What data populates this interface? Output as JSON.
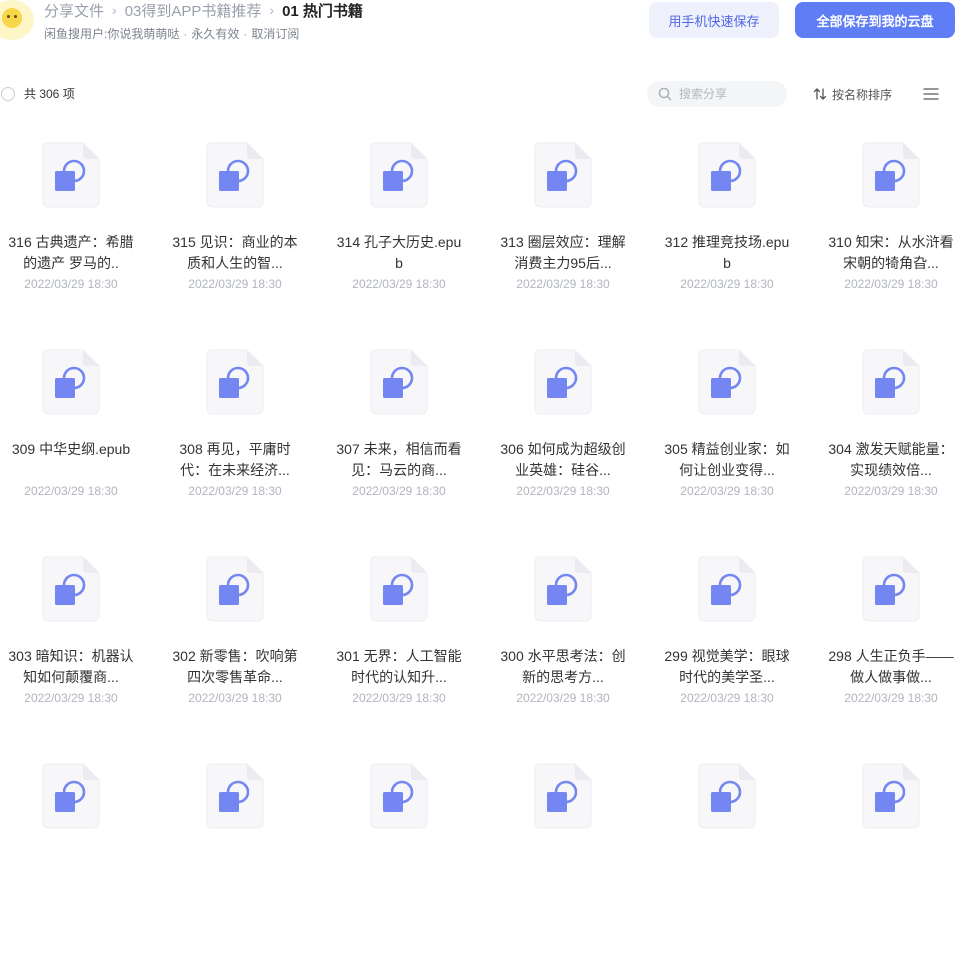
{
  "header": {
    "breadcrumb": [
      "分享文件",
      "03得到APP书籍推荐",
      "01 热门书籍"
    ],
    "separator": "›",
    "sharer": "闲鱼搜用户:你说我萌萌哒",
    "validity": "永久有效",
    "unsubscribe": "取消订阅",
    "dot": "·",
    "save_phone_label": "用手机快速保存",
    "save_all_label": "全部保存到我的云盘"
  },
  "toolbar": {
    "count_label": "共 306 项",
    "search_placeholder": "搜索分享",
    "sort_label": "按名称排序"
  },
  "colors": {
    "accent": "#5f7ef5",
    "file_icon_front": "#7386f2",
    "file_icon_back": "#f7f6f9"
  },
  "files": [
    {
      "name": "316 古典遗产：希腊的遗产 罗马的..",
      "date": "2022/03/29 18:30"
    },
    {
      "name": "315 见识：商业的本质和人生的智...",
      "date": "2022/03/29 18:30"
    },
    {
      "name": "314 孔子大历史.epub",
      "date": "2022/03/29 18:30"
    },
    {
      "name": "313 圈层效应：理解消费主力95后...",
      "date": "2022/03/29 18:30"
    },
    {
      "name": "312 推理竞技场.epub",
      "date": "2022/03/29 18:30"
    },
    {
      "name": "310 知宋：从水浒看宋朝的犄角旮...",
      "date": "2022/03/29 18:30"
    },
    {
      "name": "309 中华史纲.epub",
      "date": "2022/03/29 18:30"
    },
    {
      "name": "308 再见，平庸时代：在未来经济...",
      "date": "2022/03/29 18:30"
    },
    {
      "name": "307 未来，相信而看见：马云的商...",
      "date": "2022/03/29 18:30"
    },
    {
      "name": "306 如何成为超级创业英雄：硅谷...",
      "date": "2022/03/29 18:30"
    },
    {
      "name": "305 精益创业家：如何让创业变得...",
      "date": "2022/03/29 18:30"
    },
    {
      "name": "304 激发天赋能量：实现绩效倍...",
      "date": "2022/03/29 18:30"
    },
    {
      "name": "303 暗知识：机器认知如何颠覆商...",
      "date": "2022/03/29 18:30"
    },
    {
      "name": "302 新零售：吹响第四次零售革命...",
      "date": "2022/03/29 18:30"
    },
    {
      "name": "301 无界：人工智能时代的认知升...",
      "date": "2022/03/29 18:30"
    },
    {
      "name": "300 水平思考法：创新的思考方...",
      "date": "2022/03/29 18:30"
    },
    {
      "name": "299 视觉美学：眼球时代的美学圣...",
      "date": "2022/03/29 18:30"
    },
    {
      "name": "298 人生正负手——做人做事做...",
      "date": "2022/03/29 18:30"
    },
    {
      "name": "",
      "date": ""
    },
    {
      "name": "",
      "date": ""
    },
    {
      "name": "",
      "date": ""
    },
    {
      "name": "",
      "date": ""
    },
    {
      "name": "",
      "date": ""
    },
    {
      "name": "",
      "date": ""
    }
  ]
}
